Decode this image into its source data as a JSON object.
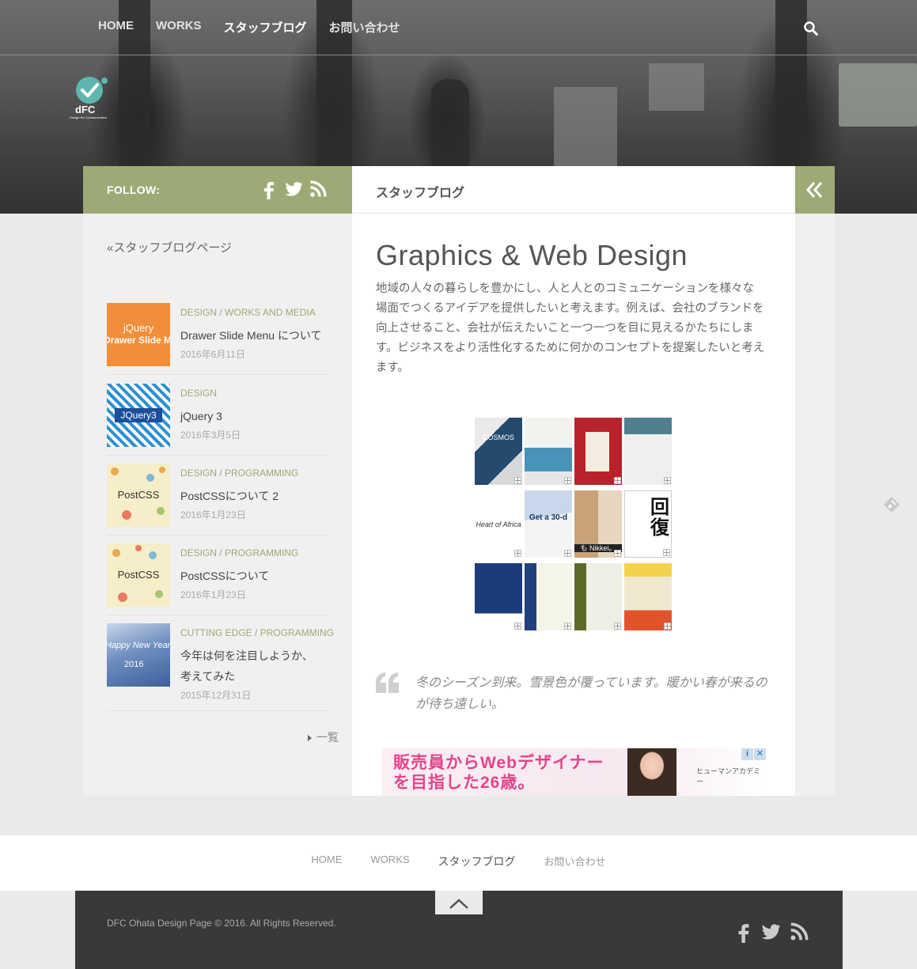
{
  "header": {
    "nav": [
      {
        "label": "HOME"
      },
      {
        "label": "WORKS"
      },
      {
        "label": "スタッフブログ"
      },
      {
        "label": "お問い合わせ"
      }
    ],
    "logo_text": "dFC",
    "logo_subtitle": "Design for Communication"
  },
  "sidebar": {
    "follow_label": "FOLLOW:",
    "follow_icons": [
      "facebook-icon",
      "twitter-icon",
      "rss-icon"
    ],
    "back_link": "«スタッフブログページ",
    "posts": [
      {
        "cats": [
          "DESIGN",
          "WORKS AND MEDIA"
        ],
        "title": "Drawer Slide Menu について",
        "date": "2016年6月11日",
        "thumb_text_1": "jQuery",
        "thumb_text_2": "Drawer Slide Menu"
      },
      {
        "cats": [
          "DESIGN"
        ],
        "title": "jQuery 3",
        "date": "2016年3月5日",
        "thumb_text_1": "JQuery3"
      },
      {
        "cats": [
          "DESIGN",
          "PROGRAMMING"
        ],
        "title": "PostCSSについて 2",
        "date": "2016年1月23日",
        "thumb_text_1": "PostCSS"
      },
      {
        "cats": [
          "DESIGN",
          "PROGRAMMING"
        ],
        "title": "PostCSSについて",
        "date": "2016年1月23日",
        "thumb_text_1": "PostCSS"
      },
      {
        "cats": [
          "CUTTING EDGE",
          "PROGRAMMING"
        ],
        "title": "今年は何を注目しようか、考えてみた",
        "date": "2015年12月31日",
        "thumb_text_1": "Happy New Year",
        "thumb_text_2": "2016"
      }
    ],
    "more_label": "一覧"
  },
  "main": {
    "page_heading": "スタッフブログ",
    "post_title": "Graphics & Web Design",
    "intro": "地域の人々の暮らしを豊かにし、人と人とのコミュニケーションを様々な場面でつくるアイデアを提供したいと考えます。例えば、会社のブランドを向上させること、会社が伝えたいこと一つ一つを目に見えるかたちにします。ビジネスをより活性化するために何かのコンセプトを提案したいと考えます。",
    "gallery_captions": [
      "COSMOS",
      "Heart of Africa",
      "Get a 30-d",
      "も Nikkei。",
      "回復"
    ],
    "quote": "冬のシーズン到来。雪景色が覆っています。暖かい春が来るのが待ち遠しい。",
    "ad": {
      "copy_line1": "販売員からWebデザイナー",
      "copy_line2": "を目指した26歳。",
      "brand": "ヒューマンアカデミー",
      "info": "i",
      "close": "✕"
    }
  },
  "footer": {
    "nav": [
      {
        "label": "HOME"
      },
      {
        "label": "WORKS"
      },
      {
        "label": "スタッフブログ"
      },
      {
        "label": "お問い合わせ"
      }
    ],
    "copyright": "DFC Ohata Design Page © 2016. All Rights Reserved.",
    "social_icons": [
      "facebook-icon",
      "twitter-icon",
      "rss-icon"
    ]
  },
  "colors": {
    "accent": "#9eaa76",
    "footer_bg": "#39393b",
    "page_bg": "#eaeaea"
  }
}
